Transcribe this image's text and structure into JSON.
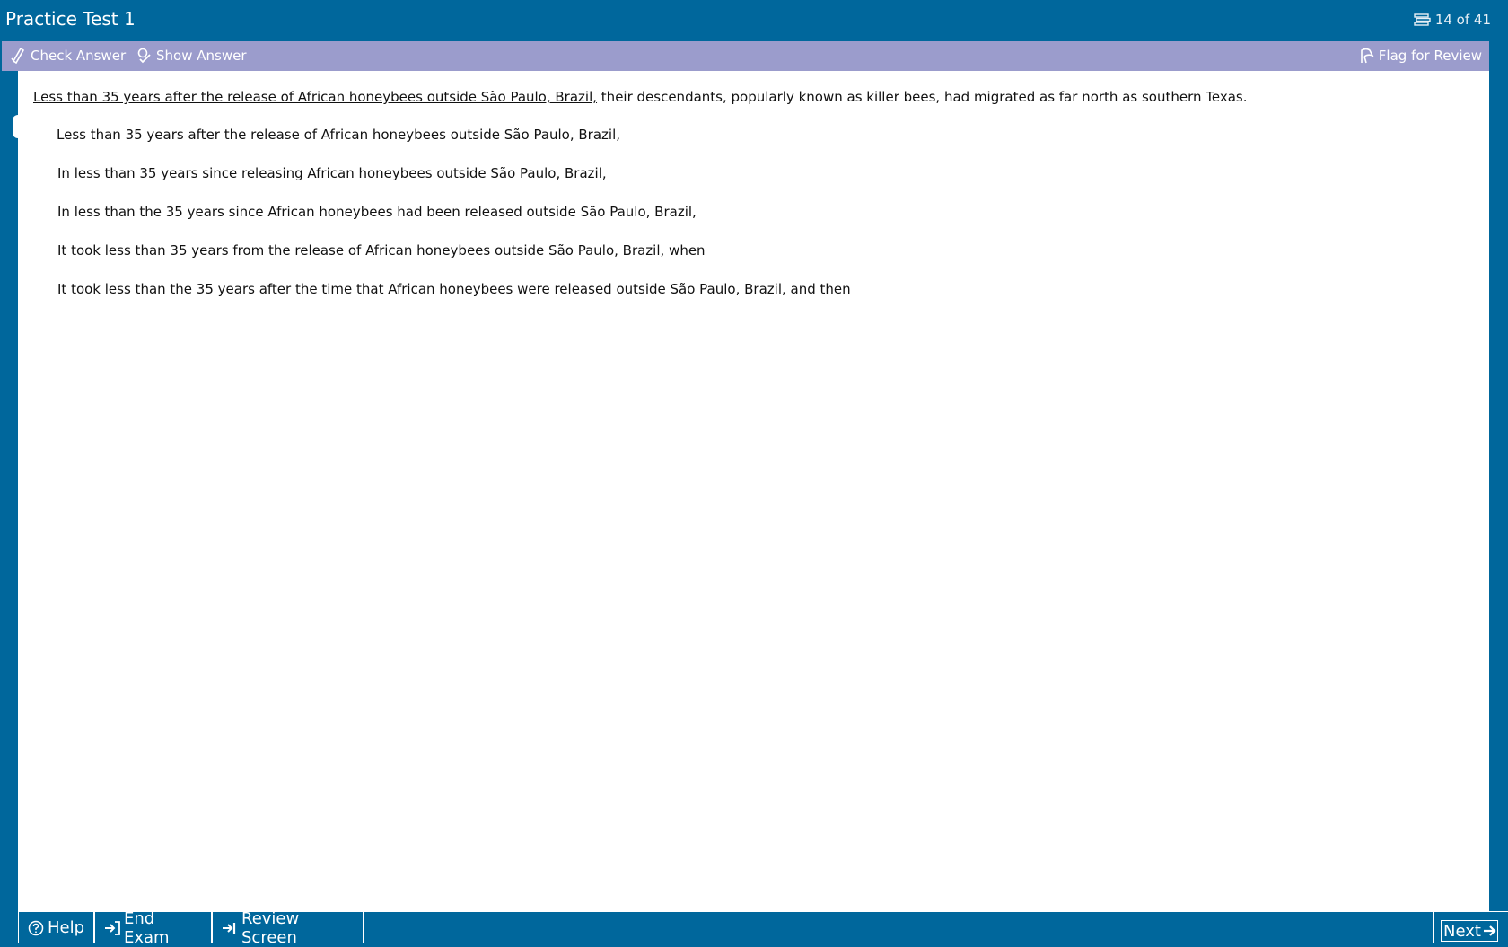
{
  "title_bar": {
    "title": "Practice Test 1",
    "counter": "14 of 41",
    "counter_icon": "stacked-pages-icon"
  },
  "toolbar": {
    "check_answer": "Check Answer",
    "show_answer": "Show Answer",
    "flag_for_review": "Flag for Review",
    "icons": {
      "check": "pen-check-icon",
      "show": "magnifier-check-icon",
      "flag": "flag-hand-icon"
    }
  },
  "question": {
    "underlined_part": "Less than 35 years after the release of African honeybees outside São Paulo, Brazil,",
    "rest": " their descendants, popularly known as killer bees, had migrated as far north as southern Texas."
  },
  "answers": [
    "Less than 35 years after the release of African honeybees outside São Paulo, Brazil,",
    "In less than 35 years since releasing African honeybees outside São Paulo, Brazil,",
    "In less than the 35 years since African honeybees had been released outside São Paulo, Brazil,",
    "It took less than 35 years from the release of African honeybees outside São Paulo, Brazil, when",
    "It took less than the 35 years after the time that African honeybees were released outside São Paulo, Brazil, and then"
  ],
  "bottom_bar": {
    "help": "Help",
    "end_exam": "End Exam",
    "review_screen": "Review Screen",
    "next": "Next"
  },
  "colors": {
    "frame_blue": "#00679c",
    "toolbar_lavender": "#9b9ccc",
    "content_bg": "#ffffff"
  }
}
